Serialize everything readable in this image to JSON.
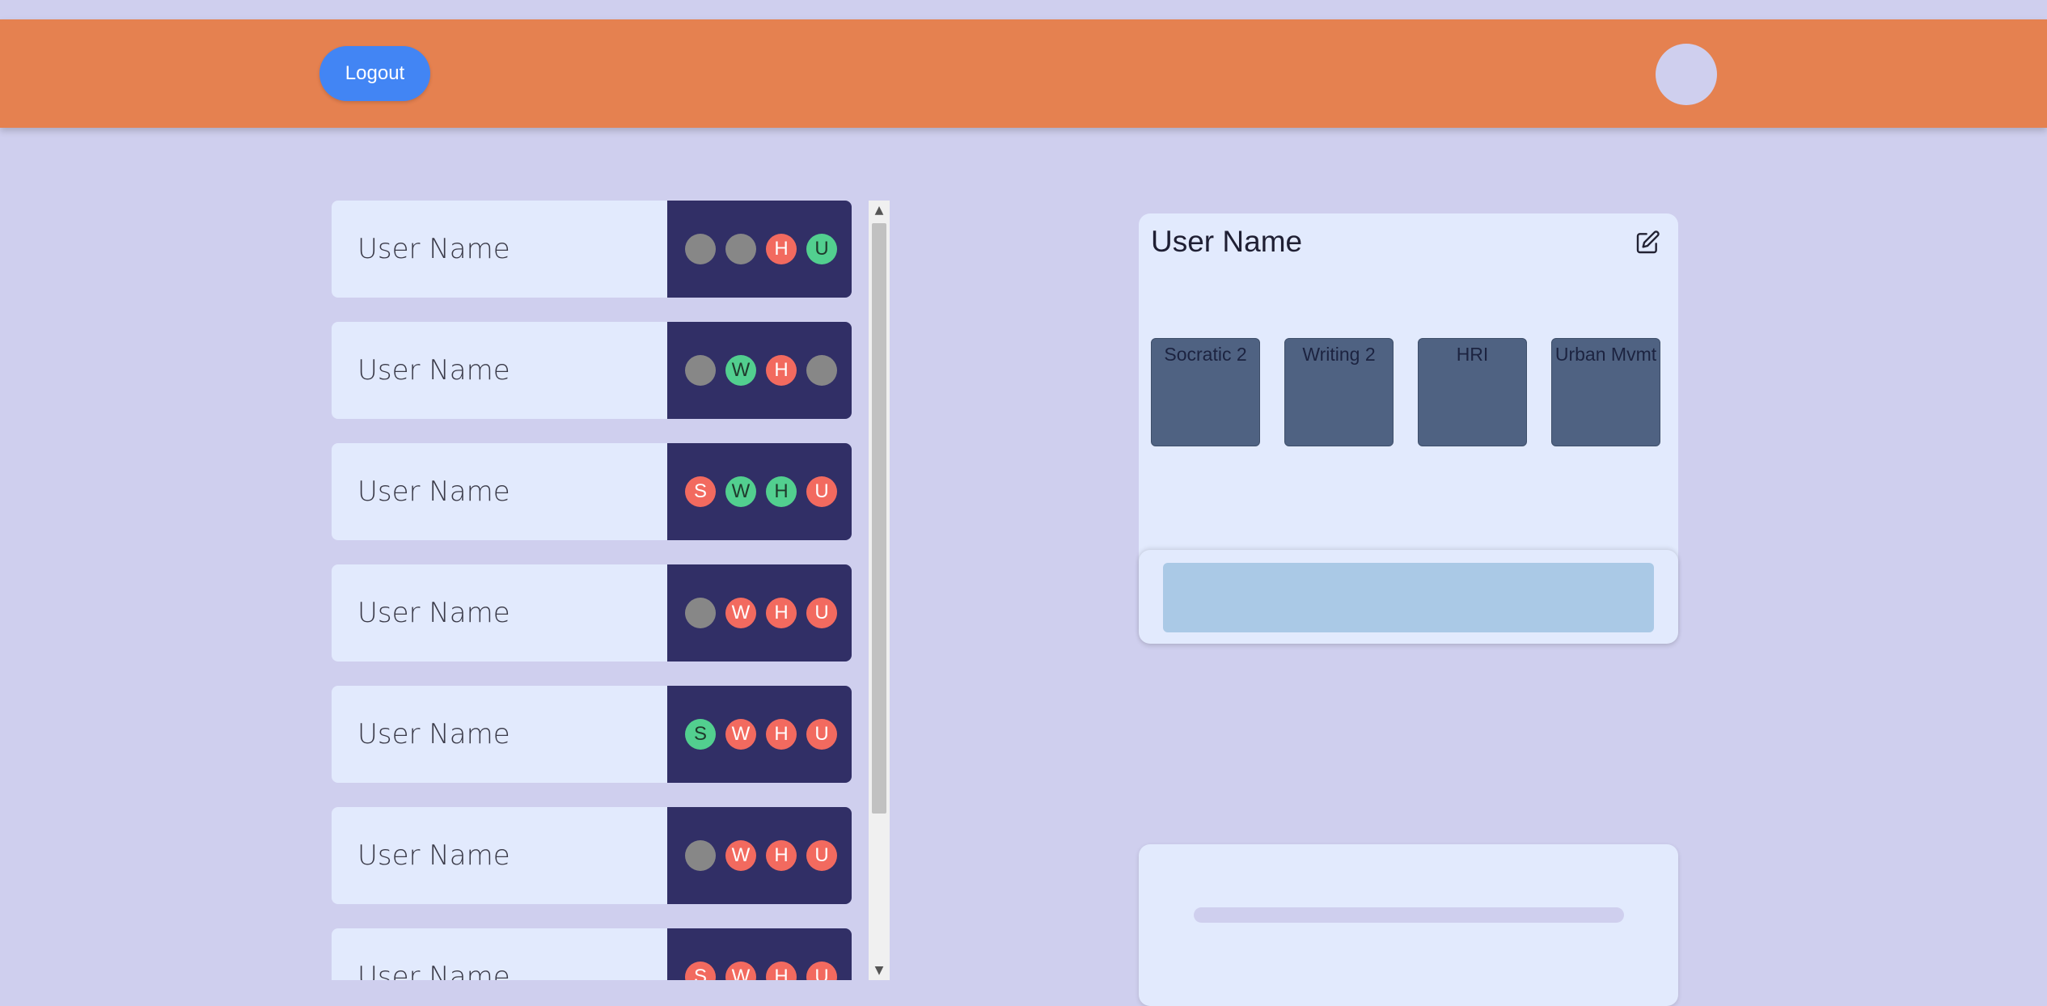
{
  "header": {
    "logout_label": "Logout"
  },
  "users": [
    {
      "name": "User Name",
      "badges": [
        {
          "letter": "",
          "status": "gray"
        },
        {
          "letter": "",
          "status": "gray"
        },
        {
          "letter": "H",
          "status": "red"
        },
        {
          "letter": "U",
          "status": "green"
        }
      ]
    },
    {
      "name": "User Name",
      "badges": [
        {
          "letter": "",
          "status": "gray"
        },
        {
          "letter": "W",
          "status": "green"
        },
        {
          "letter": "H",
          "status": "red"
        },
        {
          "letter": "",
          "status": "gray"
        }
      ]
    },
    {
      "name": "User Name",
      "badges": [
        {
          "letter": "S",
          "status": "red"
        },
        {
          "letter": "W",
          "status": "green"
        },
        {
          "letter": "H",
          "status": "green"
        },
        {
          "letter": "U",
          "status": "red"
        }
      ]
    },
    {
      "name": "User Name",
      "badges": [
        {
          "letter": "",
          "status": "gray"
        },
        {
          "letter": "W",
          "status": "red"
        },
        {
          "letter": "H",
          "status": "red"
        },
        {
          "letter": "U",
          "status": "red"
        }
      ]
    },
    {
      "name": "User Name",
      "badges": [
        {
          "letter": "S",
          "status": "green"
        },
        {
          "letter": "W",
          "status": "red"
        },
        {
          "letter": "H",
          "status": "red"
        },
        {
          "letter": "U",
          "status": "red"
        }
      ]
    },
    {
      "name": "User Name",
      "badges": [
        {
          "letter": "",
          "status": "gray"
        },
        {
          "letter": "W",
          "status": "red"
        },
        {
          "letter": "H",
          "status": "red"
        },
        {
          "letter": "U",
          "status": "red"
        }
      ]
    },
    {
      "name": "User Name",
      "badges": [
        {
          "letter": "S",
          "status": "red"
        },
        {
          "letter": "W",
          "status": "red"
        },
        {
          "letter": "H",
          "status": "red"
        },
        {
          "letter": "U",
          "status": "red"
        }
      ]
    }
  ],
  "profile": {
    "name": "User Name",
    "courses": [
      "Socratic 2",
      "Writing 2",
      "HRI",
      "Urban Mvmt"
    ]
  },
  "colors": {
    "header": "#e58150",
    "background": "#cfcfee",
    "logout_button": "#4285f4",
    "badge_red": "#f26a5f",
    "badge_green": "#52cf8f",
    "badge_gray": "#878787",
    "badge_panel": "#312f66",
    "course_tile": "#4f6282"
  },
  "icons": {
    "edit": "pencil-square-icon",
    "scroll_up": "triangle-up-icon",
    "scroll_down": "triangle-down-icon"
  }
}
